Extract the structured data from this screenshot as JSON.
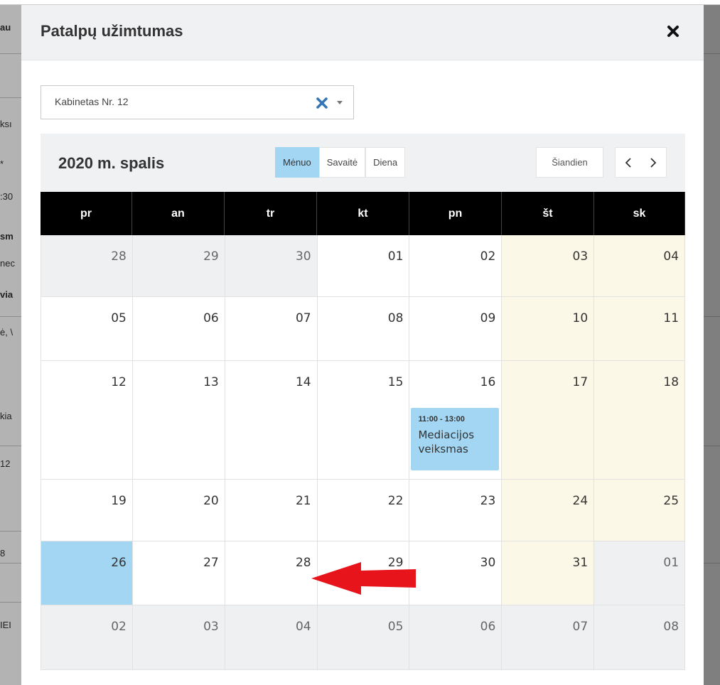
{
  "background": {
    "left_fragments": [
      {
        "text": "au",
        "bold": true
      },
      {
        "text": "ksı",
        "bold": false
      },
      {
        "text": "*",
        "bold": false
      },
      {
        "text": ":30",
        "bold": false
      },
      {
        "text": "sm",
        "bold": true
      },
      {
        "text": "nec",
        "bold": false
      },
      {
        "text": "via",
        "bold": true
      },
      {
        "text": "ė, \\",
        "bold": false
      },
      {
        "text": "kia",
        "bold": false
      },
      {
        "text": "12",
        "bold": false
      },
      {
        "text": "8",
        "bold": false
      },
      {
        "text": "IEI",
        "bold": false
      }
    ]
  },
  "modal": {
    "title": "Patalpų užimtumas",
    "close_icon": "close-icon"
  },
  "room_select": {
    "value": "Kabinetas Nr. 12",
    "clear_icon": "clear-icon",
    "caret_icon": "chevron-down-icon"
  },
  "calendar": {
    "title": "2020 m. spalis",
    "views": [
      {
        "label": "Mėnuo",
        "active": true
      },
      {
        "label": "Savaitė",
        "active": false
      },
      {
        "label": "Diena",
        "active": false
      }
    ],
    "today_label": "Šiandien",
    "prev_icon": "chevron-left-icon",
    "next_icon": "chevron-right-icon",
    "weekdays": [
      "pr",
      "an",
      "tr",
      "kt",
      "pn",
      "št",
      "sk"
    ],
    "weeks": [
      [
        {
          "day": "28",
          "kind": "other"
        },
        {
          "day": "29",
          "kind": "other"
        },
        {
          "day": "30",
          "kind": "other"
        },
        {
          "day": "01",
          "kind": "normal"
        },
        {
          "day": "02",
          "kind": "normal"
        },
        {
          "day": "03",
          "kind": "weekend"
        },
        {
          "day": "04",
          "kind": "weekend"
        }
      ],
      [
        {
          "day": "05",
          "kind": "normal"
        },
        {
          "day": "06",
          "kind": "normal"
        },
        {
          "day": "07",
          "kind": "normal"
        },
        {
          "day": "08",
          "kind": "normal"
        },
        {
          "day": "09",
          "kind": "normal"
        },
        {
          "day": "10",
          "kind": "weekend"
        },
        {
          "day": "11",
          "kind": "weekend"
        }
      ],
      [
        {
          "day": "12",
          "kind": "normal"
        },
        {
          "day": "13",
          "kind": "normal"
        },
        {
          "day": "14",
          "kind": "normal"
        },
        {
          "day": "15",
          "kind": "normal"
        },
        {
          "day": "16",
          "kind": "normal",
          "event": {
            "time": "11:00 - 13:00",
            "title": "Mediacijos veiksmas"
          }
        },
        {
          "day": "17",
          "kind": "weekend"
        },
        {
          "day": "18",
          "kind": "weekend"
        }
      ],
      [
        {
          "day": "19",
          "kind": "normal"
        },
        {
          "day": "20",
          "kind": "normal"
        },
        {
          "day": "21",
          "kind": "normal"
        },
        {
          "day": "22",
          "kind": "normal"
        },
        {
          "day": "23",
          "kind": "normal"
        },
        {
          "day": "24",
          "kind": "weekend"
        },
        {
          "day": "25",
          "kind": "weekend"
        }
      ],
      [
        {
          "day": "26",
          "kind": "today"
        },
        {
          "day": "27",
          "kind": "normal"
        },
        {
          "day": "28",
          "kind": "normal"
        },
        {
          "day": "29",
          "kind": "normal"
        },
        {
          "day": "30",
          "kind": "normal"
        },
        {
          "day": "31",
          "kind": "weekend"
        },
        {
          "day": "01",
          "kind": "other"
        }
      ],
      [
        {
          "day": "02",
          "kind": "other"
        },
        {
          "day": "03",
          "kind": "other"
        },
        {
          "day": "04",
          "kind": "other"
        },
        {
          "day": "05",
          "kind": "other"
        },
        {
          "day": "06",
          "kind": "other"
        },
        {
          "day": "07",
          "kind": "other"
        },
        {
          "day": "08",
          "kind": "other"
        }
      ]
    ]
  },
  "annotation": {
    "arrow_icon": "red-arrow-icon",
    "color": "#e8141b"
  },
  "colors": {
    "accent": "#a3d6f2",
    "weekend": "#fcf8e8",
    "other_month": "#eef0f2",
    "header_bg": "#000000"
  }
}
